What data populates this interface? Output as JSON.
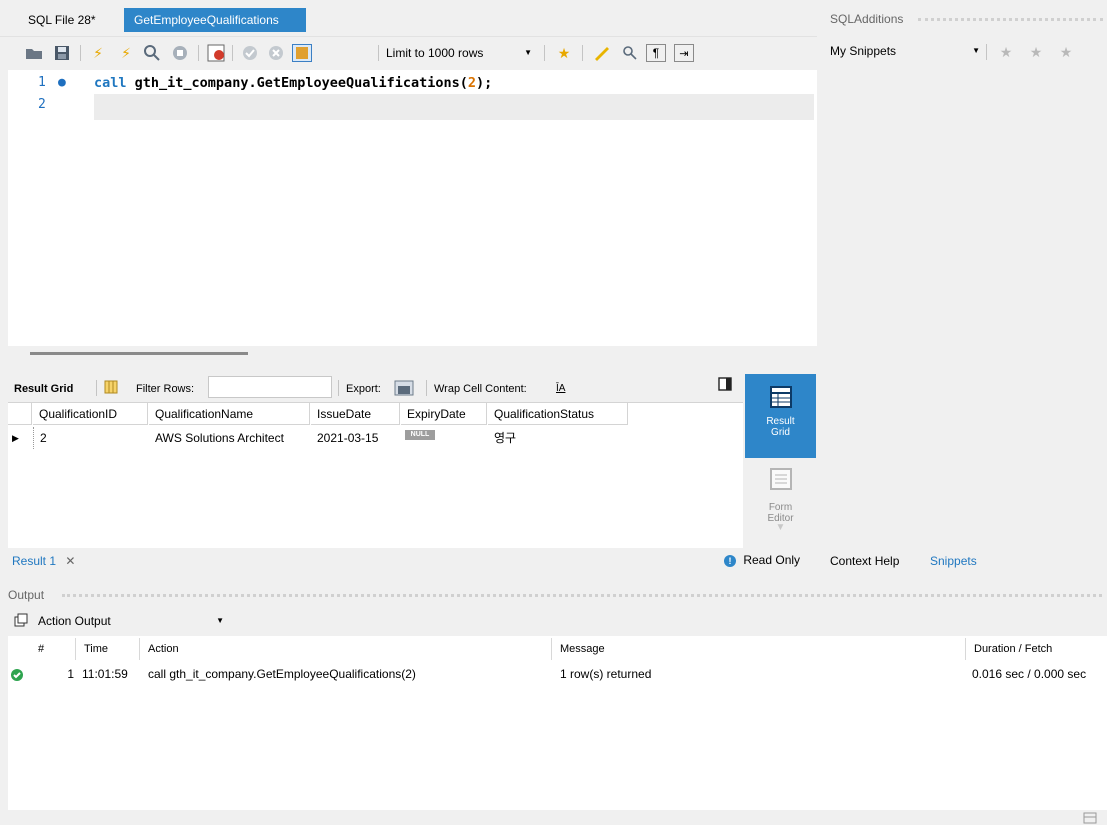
{
  "tabs": [
    {
      "label": "SQL File 28*"
    },
    {
      "label": "GetEmployeeQualifications"
    }
  ],
  "toolbar": {
    "limit_select": "Limit to 1000 rows"
  },
  "editor": {
    "lines": [
      {
        "number": "1",
        "text": "call gth_it_company.GetEmployeeQualifications(2);"
      },
      {
        "number": "2",
        "text": ""
      }
    ],
    "code_keyword": "call",
    "code_object": "gth_it_company.GetEmployeeQualifications(",
    "code_arg": "2",
    "code_end": ");"
  },
  "result_toolbar": {
    "result_grid_label": "Result Grid",
    "filter_label": "Filter Rows:",
    "filter_value": "",
    "export_label": "Export:",
    "wrap_label": "Wrap Cell Content:"
  },
  "grid": {
    "columns": [
      "QualificationID",
      "QualificationName",
      "IssueDate",
      "ExpiryDate",
      "QualificationStatus"
    ],
    "rows": [
      {
        "QualificationID": "2",
        "QualificationName": "AWS Solutions Architect",
        "IssueDate": "2021-03-15",
        "ExpiryDate": "NULL",
        "QualificationStatus": "영구"
      }
    ]
  },
  "side_buttons": {
    "result_grid": "Result Grid",
    "result_grid_line1": "Result",
    "result_grid_line2": "Grid",
    "form_editor_line1": "Form",
    "form_editor_line2": "Editor"
  },
  "result_tabs": {
    "tab_label": "Result 1",
    "read_only": "Read Only"
  },
  "right_panel": {
    "title": "SQLAdditions",
    "snippets_select": "My Snippets",
    "tab_context_help": "Context Help",
    "tab_snippets": "Snippets"
  },
  "output": {
    "title": "Output",
    "select": "Action Output",
    "columns": [
      "#",
      "Time",
      "Action",
      "Message",
      "Duration / Fetch"
    ],
    "rows": [
      {
        "num": "1",
        "time": "11:01:59",
        "action": "call gth_it_company.GetEmployeeQualifications(2)",
        "message": "1 row(s) returned",
        "duration": "0.016 sec / 0.000 sec",
        "status": "success"
      }
    ]
  },
  "colors": {
    "accent": "#2e86c9",
    "keyword": "#1f77c0",
    "number": "#d97200",
    "success": "#2ea44f"
  }
}
